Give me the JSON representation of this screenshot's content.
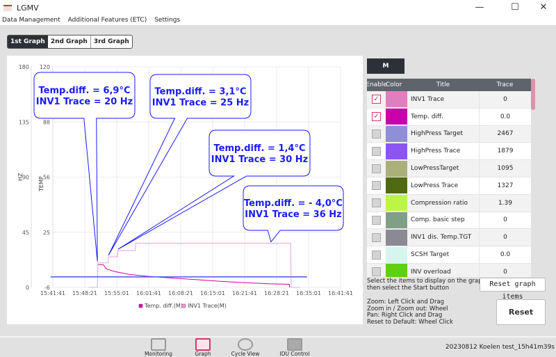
{
  "window": {
    "title": "LGMV",
    "minimize": "—",
    "maximize": "☐",
    "close": "✕"
  },
  "menu": [
    "Data Management",
    "Additional Features (ETC)",
    "Settings"
  ],
  "tabs": [
    "1st Graph",
    "2nd Graph",
    "3rd Graph"
  ],
  "right": {
    "m_button": "M",
    "headers": [
      "Enable",
      "Color",
      "Title",
      "Trace"
    ],
    "rows": [
      {
        "enabled": true,
        "color": "#e07fbe",
        "title": "INV1 Trace",
        "trace": "0"
      },
      {
        "enabled": true,
        "color": "#cc00aa",
        "title": "Temp. diff.",
        "trace": "0.0"
      },
      {
        "enabled": false,
        "color": "#8f8fd9",
        "title": "HighPress Target",
        "trace": "2467"
      },
      {
        "enabled": false,
        "color": "#8a55f2",
        "title": "HighPress Trace",
        "trace": "1879"
      },
      {
        "enabled": false,
        "color": "#abb07a",
        "title": "LowPressTarget",
        "trace": "1095"
      },
      {
        "enabled": false,
        "color": "#4f6a10",
        "title": "LowPress Trace",
        "trace": "1327"
      },
      {
        "enabled": false,
        "color": "#bdf545",
        "title": "Compression ratio",
        "trace": "1.39"
      },
      {
        "enabled": false,
        "color": "#7f9f86",
        "title": "Comp. basic step",
        "trace": "0"
      },
      {
        "enabled": false,
        "color": "#8a8a95",
        "title": "INV1 dis. Temp.TGT",
        "trace": "0"
      },
      {
        "enabled": false,
        "color": "#d5f5ee",
        "title": "SCSH Target",
        "trace": "0.0"
      },
      {
        "enabled": false,
        "color": "#5fcf10",
        "title": "INV overload",
        "trace": "0"
      }
    ],
    "hint1": [
      "Select the items to display on the graph,",
      "then select the Start button"
    ],
    "reset_items": "Reset graph items",
    "hint2": [
      "Zoom: Left Click and Drag",
      "Zoom in / Zoom out: Wheel",
      "Pan: Right Click and Drag",
      "Reset to Default: Wheel Click"
    ],
    "reset": "Reset"
  },
  "bottom": {
    "nav": [
      "Monitoring",
      "Graph",
      "Cycle View",
      "IDU Control"
    ],
    "active": "Graph",
    "file": "20230812 Koelen test_15h41m39s"
  },
  "chart_data": {
    "type": "line",
    "x_ticks": [
      "15:41:41",
      "15:48:21",
      "15:55:01",
      "16:01:41",
      "16:08:21",
      "16:15:01",
      "16:21:41",
      "16:28:21",
      "16:35:01",
      "16:41:41"
    ],
    "x_unit": "minutes after 15:41:41",
    "xlim": [
      0,
      60
    ],
    "y_left": {
      "label": "HZ",
      "ticks": [
        "180",
        "135",
        "90",
        "45",
        "0"
      ],
      "lim": [
        0,
        180
      ]
    },
    "y_right": {
      "label": "TEMP",
      "ticks": [
        "120",
        "88",
        "56",
        "25",
        "-6"
      ],
      "lim": [
        -6,
        120
      ]
    },
    "series": [
      {
        "name": "Temp. diff.(M)",
        "axis": "temp",
        "color": "#cc00aa",
        "points": [
          [
            9.3,
            7.0
          ],
          [
            10.5,
            7.0
          ],
          [
            11.2,
            4.5
          ],
          [
            13,
            3.0
          ],
          [
            16,
            1.4
          ],
          [
            20,
            0.3
          ],
          [
            25,
            -0.7
          ],
          [
            30,
            -1.6
          ],
          [
            35,
            -2.5
          ],
          [
            40,
            -3.3
          ],
          [
            45,
            -3.9
          ],
          [
            49.3,
            -4.2
          ],
          [
            49.4,
            -6
          ]
        ]
      },
      {
        "name": "INV1 Trace(M)",
        "axis": "hz",
        "color": "#f0a0d8",
        "points": [
          [
            7.5,
            0
          ],
          [
            9.3,
            0
          ],
          [
            9.4,
            20
          ],
          [
            11.5,
            20
          ],
          [
            11.6,
            25
          ],
          [
            13.5,
            25
          ],
          [
            13.6,
            30
          ],
          [
            17.2,
            30
          ],
          [
            17.3,
            36
          ],
          [
            49.6,
            36
          ],
          [
            49.7,
            0
          ],
          [
            51.5,
            0
          ]
        ]
      },
      {
        "name": "reference",
        "axis": "temp",
        "color": "#4a55e8",
        "points": [
          [
            -0.5,
            0
          ],
          [
            53,
            0
          ]
        ]
      }
    ],
    "annotations": [
      {
        "lines": [
          "Temp.diff. = 6,9°C",
          "INV1 Trace = 20 Hz"
        ],
        "at": [
          9.3,
          20
        ]
      },
      {
        "lines": [
          "Temp.diff. = 3,1°C",
          "INV1 Trace = 25 Hz"
        ],
        "at": [
          11.6,
          25
        ]
      },
      {
        "lines": [
          "Temp.diff. = 1,4°C",
          "INV1 Trace = 30 Hz"
        ],
        "at": [
          13.6,
          30
        ]
      },
      {
        "lines": [
          "Temp.diff. = - 4,0°C",
          "INV1 Trace = 36 Hz"
        ],
        "at": [
          45.5,
          36
        ]
      }
    ],
    "legend": [
      "Temp. diff.(M)",
      "INV1 Trace(M)"
    ],
    "legend_position": "bottom"
  }
}
